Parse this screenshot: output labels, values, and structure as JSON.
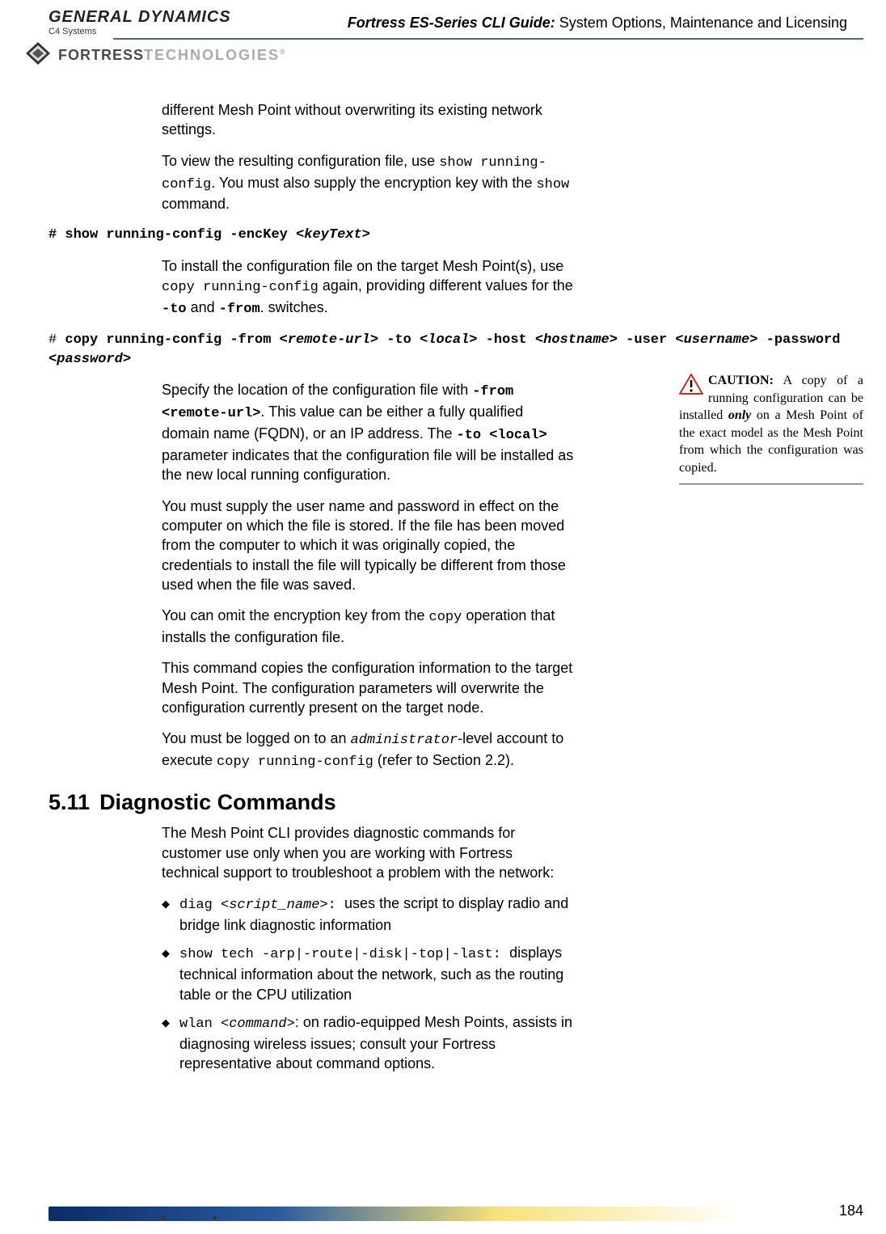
{
  "header": {
    "logo_main": "GENERAL DYNAMICS",
    "logo_sub": "C4 Systems",
    "fortress": "FORTRESS",
    "fortress_tech": "TECHNOLOGIES",
    "title_bold": "Fortress ES-Series CLI Guide:",
    "title_rest": " System Options, Maintenance and Licensing"
  },
  "paras": {
    "p1": "different Mesh Point without overwriting its existing network settings.",
    "p2a": "To view the resulting configuration file, use ",
    "p2_cmd1": "show running-config",
    "p2b": ". You must also supply the encryption key with the ",
    "p2_cmd2": "show",
    "p2c": " command.",
    "p3": "To install the configuration file on the target Mesh Point(s), use ",
    "p3_cmd1": "copy running-config",
    "p3b": " again, providing different values for the ",
    "p3_cmd2": "-to",
    "p3c": " and ",
    "p3_cmd3": "-from",
    "p3d": ". switches.",
    "p4a": "Specify the location of the configuration file with ",
    "p4_cmd1": "-from <remote-url>",
    "p4b": ". This value can be either a fully qualified domain name (FQDN), or an IP address. The ",
    "p4_cmd2": "-to <local>",
    "p4c": " parameter indicates that the configuration file will be installed as the new local running configuration.",
    "p5": "You must supply the user name and password in effect on the computer on which the file is stored. If the file has been moved from the computer to which it was originally copied, the credentials to install the file will typically be different from those used when the file was saved.",
    "p6a": "You can omit the encryption key from the ",
    "p6_cmd": "copy",
    "p6b": " operation that installs the configuration file.",
    "p7": "This command copies the configuration information to the target Mesh Point. The configuration parameters will overwrite the configuration currently present on the target node.",
    "p8a": "You must be logged on to an ",
    "p8_cmd1": "administrator",
    "p8b": "-level account to execute ",
    "p8_cmd2": "copy running-config",
    "p8c": " (refer to Section 2.2).",
    "p9": "The Mesh Point CLI provides diagnostic commands for customer use only when you are working with Fortress technical support to troubleshoot a problem with the network:"
  },
  "cmds": {
    "c1_pre": "# show running-config -encKey ",
    "c1_param": "<keyText>",
    "c2_hash": "# ",
    "c2_a": "copy running-config -from ",
    "c2_p1": "<remote-url>",
    "c2_b": " -to ",
    "c2_p2": "<local>",
    "c2_c": " -host ",
    "c2_p3": "<hostname>",
    "c2_d": " -user ",
    "c2_p4": "<username>",
    "c2_e": " -password ",
    "c2_p5": "<password>"
  },
  "section": {
    "num": "5.11",
    "title": "Diagnostic Commands"
  },
  "bullets": {
    "b1_cmd": "diag ",
    "b1_param": "<script_name>",
    "b1_colon": ": ",
    "b1_text": "uses the script to display radio and bridge link diagnostic information",
    "b2_cmd": "show tech -arp|-route|-disk|-top|-last: ",
    "b2_text": "displays technical information about the network, such as the routing table or the CPU utilization",
    "b3_cmd": "wlan ",
    "b3_param": "<command>",
    "b3_text": ": on radio-equipped Mesh Points, assists in diagnosing wireless issues; consult your Fortress representative about command options."
  },
  "sidebar": {
    "caution": "CAUTION:",
    "text_a": " A copy of a running configuration can be installed ",
    "only": "only",
    "text_b": " on a Mesh Point of the exact model as the Mesh Point from which the configuration was copied."
  },
  "footer": {
    "page": "184"
  }
}
